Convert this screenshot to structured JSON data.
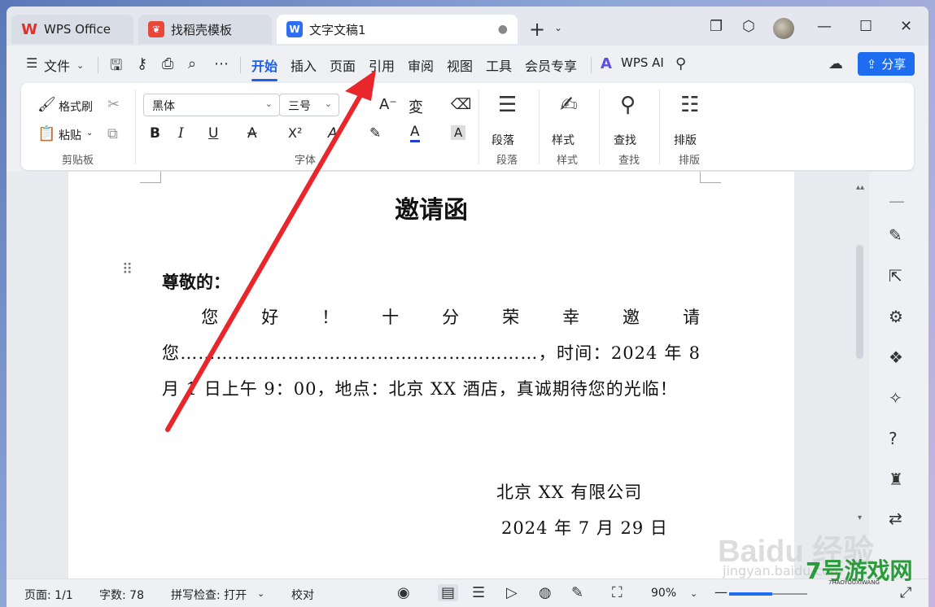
{
  "tabs": {
    "home": "WPS Office",
    "template": "找稻壳模板",
    "doc": "文字文稿1",
    "doc_icon": "W",
    "doc_dot": "●"
  },
  "menu": {
    "file": "文件",
    "items": [
      "开始",
      "插入",
      "页面",
      "引用",
      "审阅",
      "视图",
      "工具",
      "会员专享"
    ],
    "active_index": 0,
    "wps_ai": "WPS AI",
    "share": "分享"
  },
  "ribbon": {
    "format_painter": "格式刷",
    "paste": "粘贴",
    "clipboard_group": "剪贴板",
    "font_name": "黑体",
    "font_size": "三号",
    "font_group": "字体",
    "bold": "B",
    "italic": "I",
    "underline": "U",
    "strike": "A",
    "superscript": "X²",
    "paragraph": "段落",
    "paragraph_group": "段落",
    "styles": "样式",
    "styles_group": "样式",
    "find": "查找",
    "find_group": "查找",
    "layout": "排版",
    "layout_group": "排版",
    "font_color_accent": "#1e3fd0"
  },
  "document": {
    "title": "邀请函",
    "salutation": "尊敬的：",
    "body": "您好！十分荣幸邀请您……………………………………………………，时间：2024 年 8 月 1 日上午 9：00，地点：北京 XX 酒店，真诚期待您的光临！",
    "signature_company": "北京 XX 有限公司",
    "signature_date": "2024 年 7 月 29 日"
  },
  "status": {
    "page": "页面: 1/1",
    "words": "字数: 78",
    "spell": "拼写检查: 打开",
    "proof": "校对",
    "zoom": "90%",
    "zoom_fraction": 0.55
  },
  "watermark": {
    "baidu": "Baidu 经验",
    "baidu_url": "jingyan.baidu.com",
    "site": "7号游戏网",
    "site_small": "7HAOYOUXIWANG"
  },
  "colors": {
    "accent": "#1e6cf0",
    "arrow": "#e8262b"
  }
}
